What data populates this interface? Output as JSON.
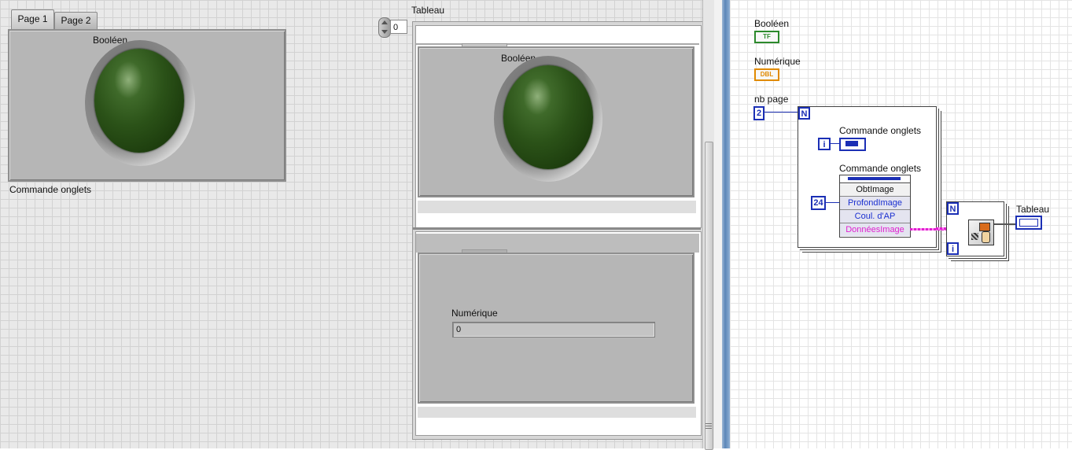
{
  "front_panel": {
    "tabs": [
      "Page 1",
      "Page 2"
    ],
    "tab_boolean_label": "Booléen",
    "tab_control_caption": "Commande onglets",
    "index_value": "0",
    "array_label": "Tableau",
    "image1_boolean_label": "Booléen",
    "image2_numeric_label": "Numérique",
    "image2_numeric_value": "0"
  },
  "block_diagram": {
    "boolean_label": "Booléen",
    "boolean_terminal": "TF",
    "numeric_label": "Numérique",
    "numeric_terminal": "DBL",
    "nbpage_label": "nb page",
    "nbpage_value": "2",
    "loop_count": "N",
    "loop_index": "i",
    "tab_control_label": "Commande onglets",
    "property_node_label": "Commande onglets",
    "property_node_method": "ObtImage",
    "property_items": [
      "ProfondImage",
      "Coul. d'AP",
      "DonnéesImage"
    ],
    "depth_value": "24",
    "array_out_label": "Tableau",
    "colors": {
      "wire_blue": "#1b2fb5",
      "wire_pink": "#e020d0",
      "boolean_green": "#2c8a2c",
      "numeric_orange": "#e08a00"
    }
  }
}
